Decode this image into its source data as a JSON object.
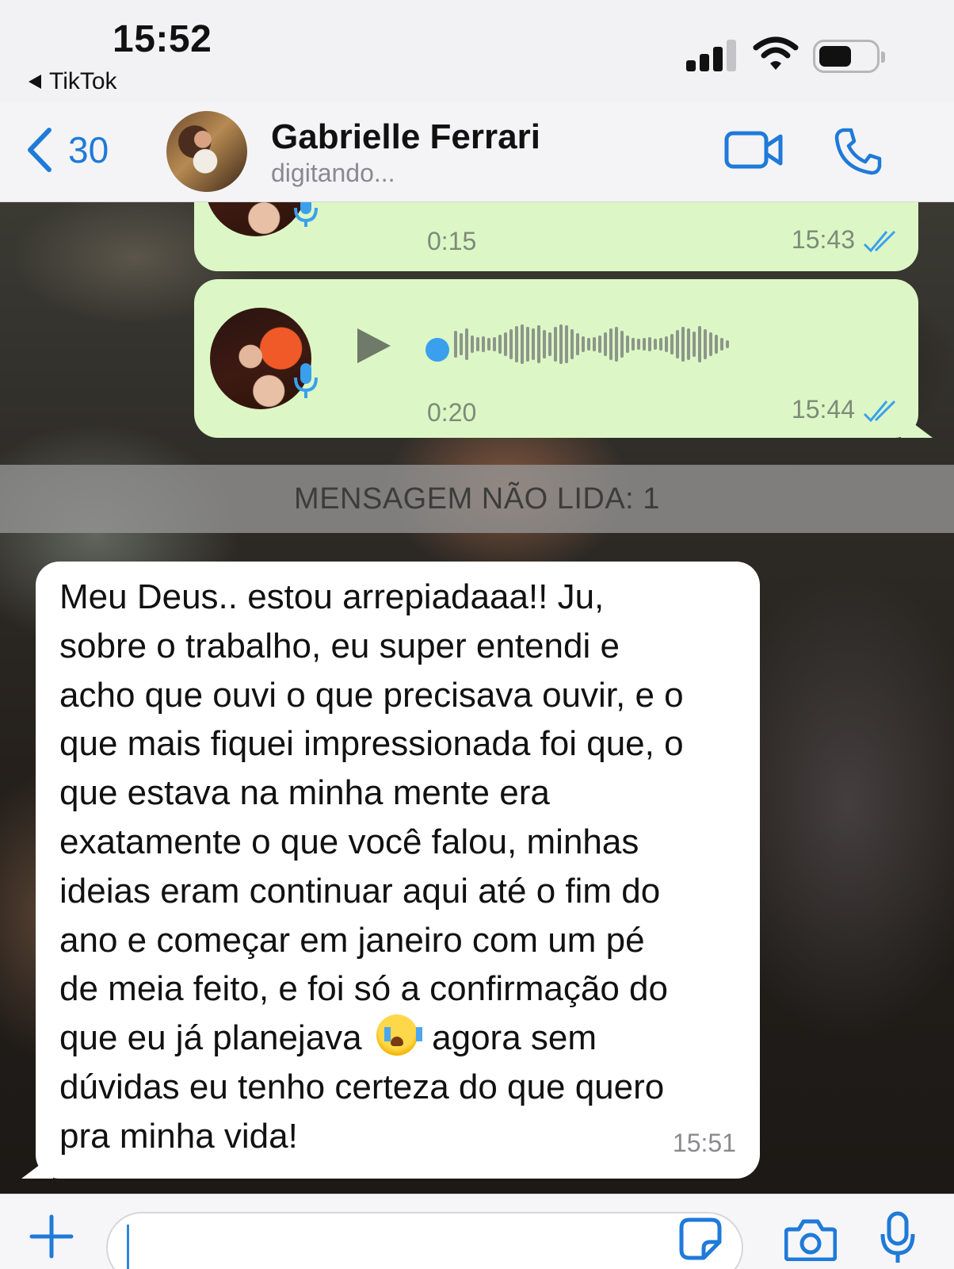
{
  "status_bar": {
    "time": "15:52",
    "back_app": "TikTok"
  },
  "header": {
    "back_count": "30",
    "contact_name": "Gabrielle Ferrari",
    "contact_status": "digitando..."
  },
  "messages": {
    "voice_1": {
      "duration": "0:15",
      "time": "15:43"
    },
    "voice_2": {
      "duration": "0:20",
      "time": "15:44"
    },
    "unread_divider": "MENSAGEM NÃO LIDA: 1",
    "incoming": {
      "lines": [
        "Meu Deus.. estou arrepiadaaa!! Ju,",
        "sobre o trabalho, eu super entendi e",
        "acho que ouvi o que precisava ouvir, e o",
        "que mais fiquei impressionada foi que, o",
        "que estava na minha mente era",
        "exatamente o que você falou, minhas",
        "ideias eram continuar aqui até o fim do",
        "ano e começar em janeiro com um pé",
        "de meia feito, e foi só a confirmação do",
        "que eu já planejava",
        "agora sem",
        "dúvidas eu tenho certeza do que quero",
        "pra minha vida!"
      ],
      "emoji": "loudly-crying-face-emoji",
      "time": "15:51"
    }
  },
  "icons": {
    "back": "chevron-left-icon",
    "video": "video-camera-icon",
    "call": "phone-icon",
    "plus": "plus-icon",
    "sticker": "sticker-icon",
    "camera": "camera-icon",
    "mic": "microphone-icon",
    "play": "play-icon"
  },
  "colors": {
    "accent": "#1f7ad8",
    "outgoing_bubble": "#dcf7c5",
    "incoming_bubble": "#ffffff",
    "read_ticks": "#3aa0ee"
  }
}
